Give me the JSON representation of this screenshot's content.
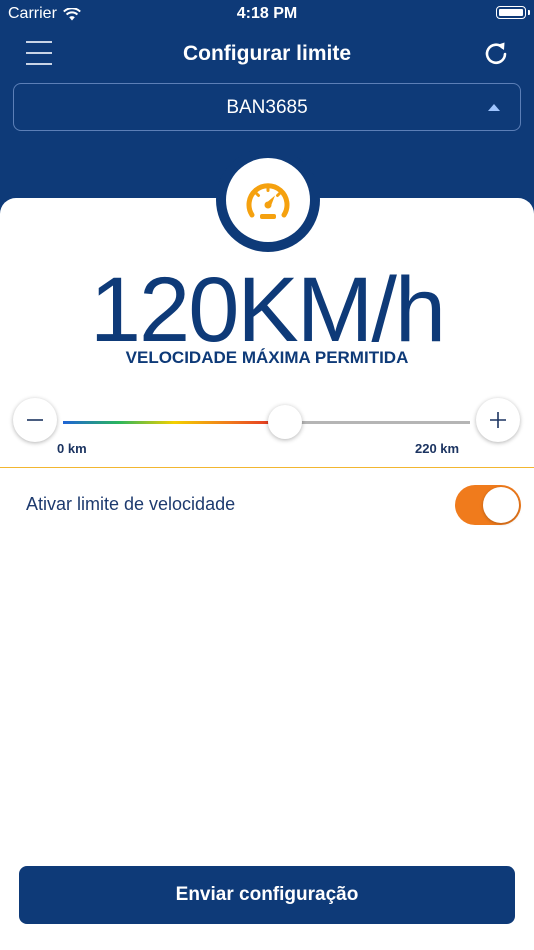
{
  "status_bar": {
    "carrier": "Carrier",
    "time": "4:18 PM",
    "icons": [
      "wifi-icon",
      "battery-icon"
    ]
  },
  "nav": {
    "title": "Configurar limite",
    "left_icon": "hamburger-menu-icon",
    "right_icon": "refresh-icon"
  },
  "vehicle_selector": {
    "value": "BAN3685",
    "icon": "caret-up-icon"
  },
  "speed_limit": {
    "icon": "speedometer-icon",
    "display": "120KM/h",
    "caption": "VELOCIDADE MÁXIMA PERMITIDA",
    "value_kmh": 120
  },
  "slider": {
    "min": 0,
    "max": 220,
    "value": 120,
    "min_label": "0 km",
    "max_label": "220 km",
    "decrement_icon": "minus-icon",
    "increment_icon": "plus-icon"
  },
  "toggle": {
    "label": "Ativar limite de velocidade",
    "checked": true
  },
  "submit": {
    "label": "Enviar configuração"
  },
  "colors": {
    "primary": "#0e3a78",
    "accent": "#f07b1c",
    "gauge": "#f5a10f",
    "divider": "#f2b630"
  }
}
